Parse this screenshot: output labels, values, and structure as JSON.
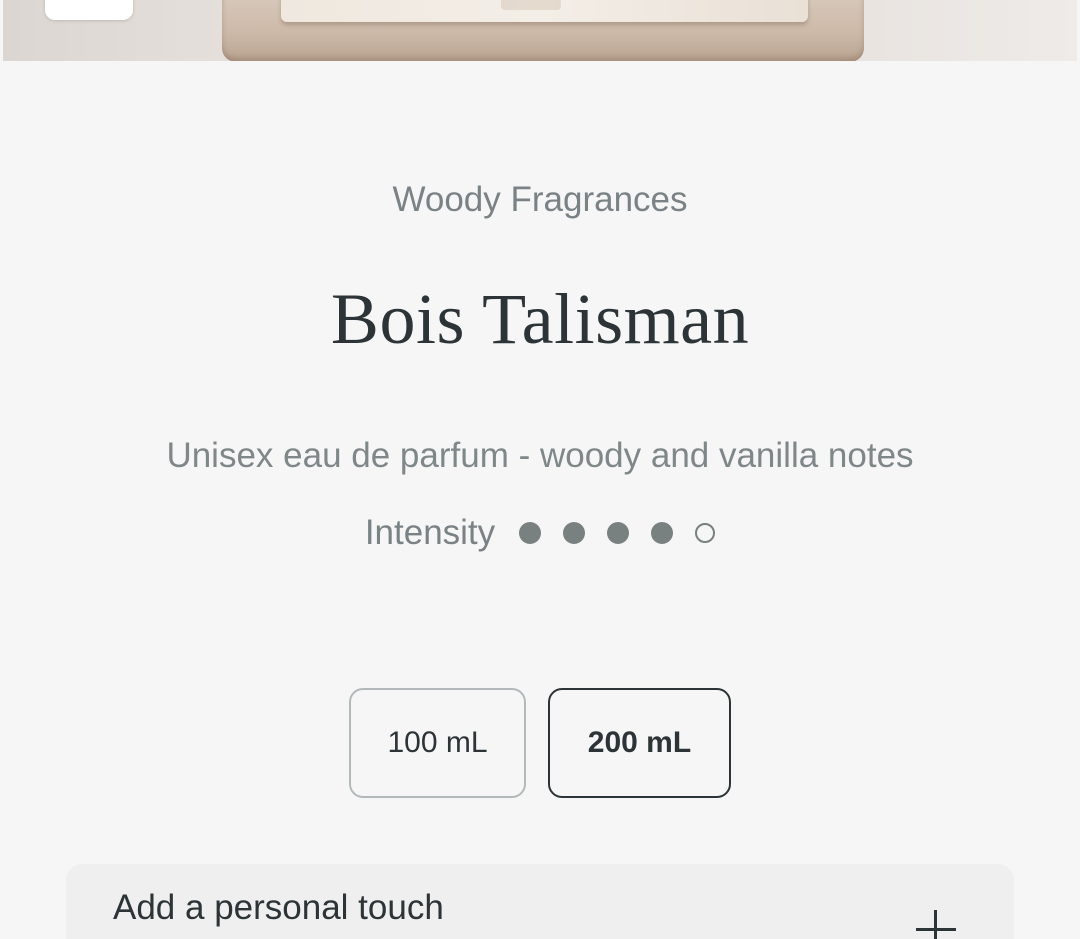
{
  "product": {
    "category": "Woody Fragrances",
    "name": "Bois Talisman",
    "description": "Unisex eau de parfum - woody and vanilla notes",
    "intensity": {
      "label": "Intensity",
      "level": 4,
      "max": 5
    }
  },
  "sizes": {
    "options": [
      {
        "label": "100 mL",
        "selected": false
      },
      {
        "label": "200 mL",
        "selected": true
      }
    ]
  },
  "personalization": {
    "title": "Add a personal touch",
    "icon": "plus-icon"
  },
  "colors": {
    "background": "#f6f6f6",
    "text_primary": "#2d3437",
    "text_secondary": "#7a8285",
    "dot": "#78817f"
  }
}
